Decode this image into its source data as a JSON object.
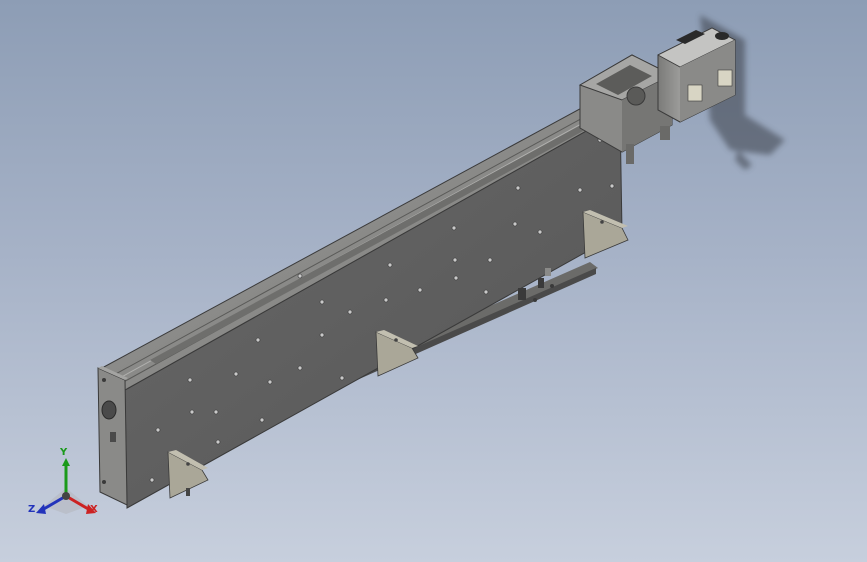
{
  "viewport": {
    "background_top": "#8d9db5",
    "background_bottom": "#c7cfdd",
    "model": {
      "body_color": "#5f5f5f",
      "body_dark": "#4c4c4c",
      "top_color": "#8c8c8a",
      "bracket_color": "#a8a596",
      "motor_color": "#9e9e9c"
    }
  },
  "triad": {
    "y_label": "Y",
    "x_label": "X",
    "z_label": "Z",
    "y_color": "#1a9a1a",
    "x_color": "#cc2222",
    "z_color": "#2233bb",
    "icon": "coordinate-triad-icon"
  }
}
